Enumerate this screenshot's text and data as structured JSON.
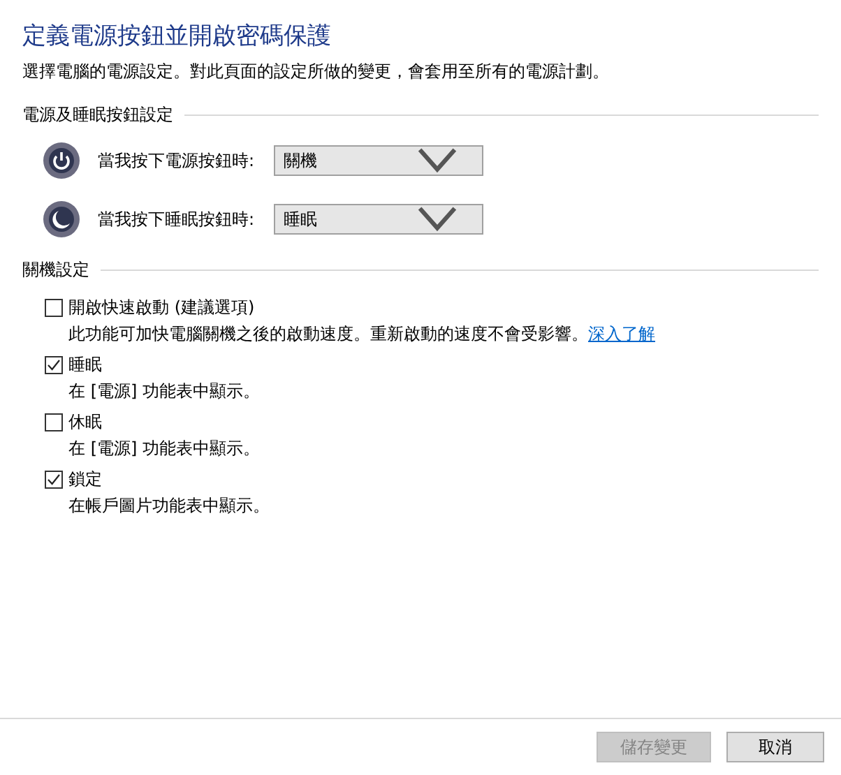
{
  "title": "定義電源按鈕並開啟密碼保護",
  "subtitle": "選擇電腦的電源設定。對此頁面的設定所做的變更，會套用至所有的電源計劃。",
  "button_settings": {
    "heading": "電源及睡眠按鈕設定",
    "rows": [
      {
        "kind": "power",
        "label": "當我按下電源按鈕時:",
        "value": "關機"
      },
      {
        "kind": "sleep",
        "label": "當我按下睡眠按鈕時:",
        "value": "睡眠"
      }
    ]
  },
  "shutdown_settings": {
    "heading": "關機設定",
    "options": [
      {
        "label": "開啟快速啟動 (建議選項)",
        "checked": false,
        "description": "此功能可加快電腦關機之後的啟動速度。重新啟動的速度不會受影響。",
        "link": "深入了解"
      },
      {
        "label": "睡眠",
        "checked": true,
        "description": "在 [電源] 功能表中顯示。"
      },
      {
        "label": "休眠",
        "checked": false,
        "description": "在 [電源] 功能表中顯示。"
      },
      {
        "label": "鎖定",
        "checked": true,
        "description": "在帳戶圖片功能表中顯示。"
      }
    ]
  },
  "buttons": [
    {
      "label": "儲存變更",
      "disabled": true
    },
    {
      "label": "取消",
      "disabled": false
    }
  ]
}
